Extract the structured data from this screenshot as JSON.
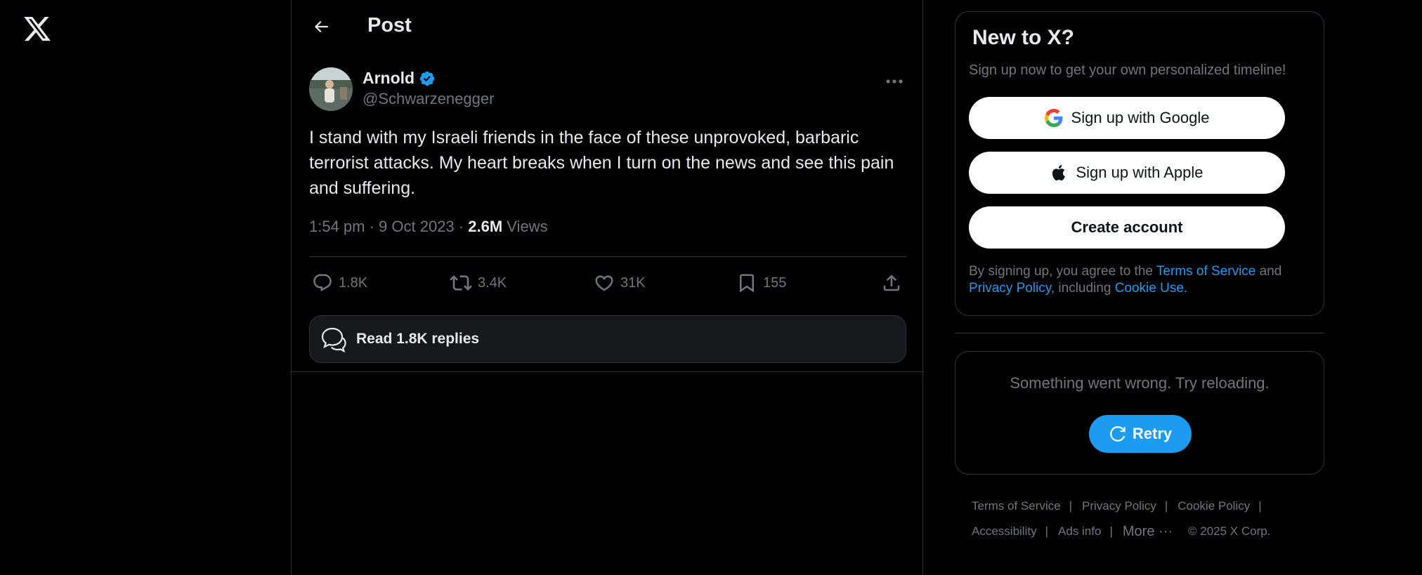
{
  "header": {
    "title": "Post"
  },
  "tweet": {
    "author_name": "Arnold",
    "author_handle": "@Schwarzenegger",
    "text": "I stand with my Israeli friends in the face of these unprovoked, barbaric terrorist attacks. My heart breaks when I turn on the news and see this pain and suffering.",
    "timestamp": "1:54 pm · 9 Oct 2023",
    "meta_sep": " · ",
    "views_count": "2.6M",
    "views_label": "Views",
    "replies": "1.8K",
    "reposts": "3.4K",
    "likes": "31K",
    "bookmarks": "155",
    "read_replies_label": "Read 1.8K replies"
  },
  "signup": {
    "title": "New to X?",
    "subtitle": "Sign up now to get your own personalized timeline!",
    "google_label": "Sign up with Google",
    "apple_label": "Sign up with Apple",
    "create_label": "Create account",
    "legal_prefix": "By signing up, you agree to the ",
    "terms_link": "Terms of Service",
    "legal_and": " and ",
    "privacy_link": "Privacy Policy",
    "legal_including": ", including ",
    "cookie_link": "Cookie Use."
  },
  "error": {
    "message": "Something went wrong. Try reloading.",
    "retry_label": "Retry"
  },
  "footer": {
    "terms": "Terms of Service",
    "privacy": "Privacy Policy",
    "cookie": "Cookie Policy",
    "accessibility": "Accessibility",
    "ads": "Ads info",
    "more": "More ···",
    "copyright": "© 2025 X Corp.",
    "separator": "|"
  },
  "icons": {
    "logo": "x-logo-icon",
    "back": "arrow-left-icon",
    "verified": "verified-badge-icon",
    "more": "more-dots-icon",
    "reply": "reply-icon",
    "repost": "repost-icon",
    "like": "heart-icon",
    "bookmark": "bookmark-icon",
    "share": "share-icon",
    "replies_bubble": "chat-bubbles-icon",
    "google": "google-icon",
    "apple": "apple-icon",
    "retry": "refresh-icon"
  },
  "colors": {
    "accent": "#1d9bf0",
    "background": "#000000",
    "text_primary": "#e7e9ea",
    "text_secondary": "#71767b",
    "border": "#2f3336"
  }
}
